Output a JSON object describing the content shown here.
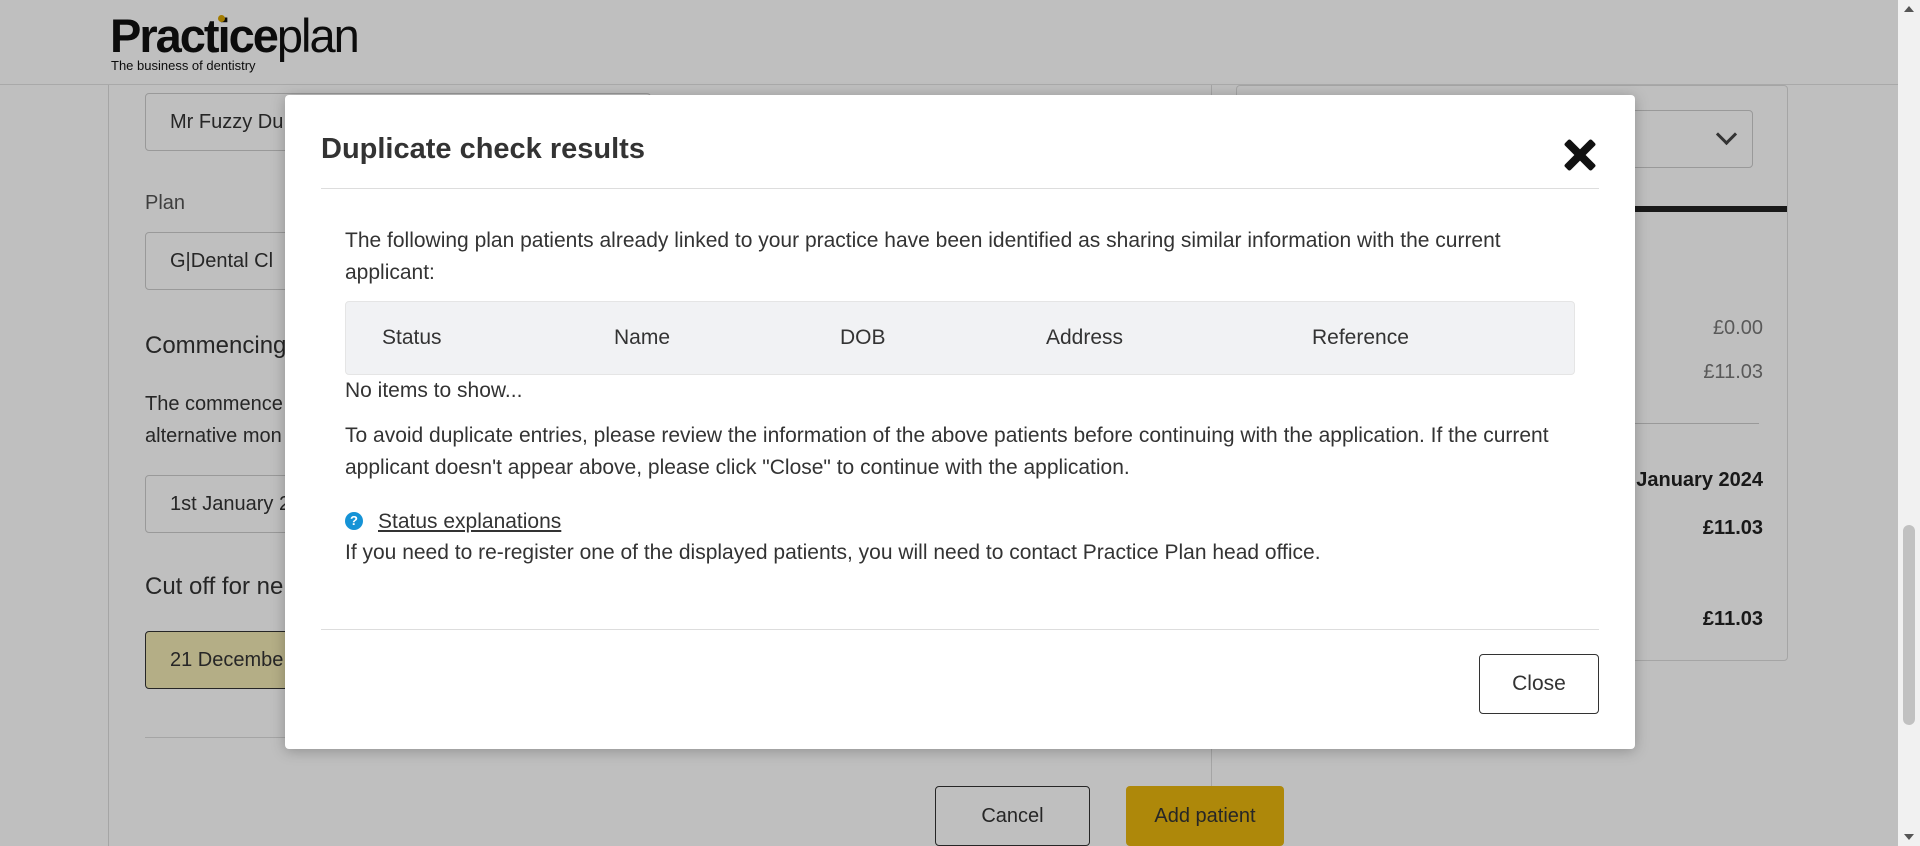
{
  "brand": {
    "logo_bold": "Practice",
    "logo_light": "plan",
    "tagline": "The business of dentistry"
  },
  "form": {
    "patient_name_value": "Mr Fuzzy Du",
    "plan_label": "Plan",
    "plan_value": "G|Dental Cl",
    "commencing_heading": "Commencing",
    "commence_text_line1": "The commence",
    "commence_text_line2": "alternative mon",
    "commence_value": "1st January 2",
    "cutoff_heading": "Cut off for ne",
    "cutoff_value": "21 Decembe",
    "cancel_label": "Cancel",
    "add_patient_label": "Add patient"
  },
  "summary": {
    "row1": "£0.00",
    "row2": "£11.03",
    "month": "January 2024",
    "total1": "£11.03",
    "total2": "£11.03"
  },
  "modal": {
    "title": "Duplicate check results",
    "intro": "The following plan patients already linked to your practice have been identified as sharing similar information with the current applicant:",
    "columns": [
      "Status",
      "Name",
      "DOB",
      "Address",
      "Reference"
    ],
    "empty_text": "No items to show...",
    "advice": "To avoid duplicate entries, please review the information of the above patients before continuing with the application. If the current applicant doesn't appear above, please click \"Close\" to continue with the application.",
    "help_icon": "question-circle-icon",
    "help_glyph": "?",
    "status_link": "Status explanations",
    "contact_text": "If you need to re-register one of the displayed patients, you will need to contact Practice Plan head office.",
    "close_label": "Close"
  },
  "colors": {
    "accent": "#e8b60e",
    "highlight_field": "#f1e8b3",
    "help_icon": "#1593d6"
  }
}
